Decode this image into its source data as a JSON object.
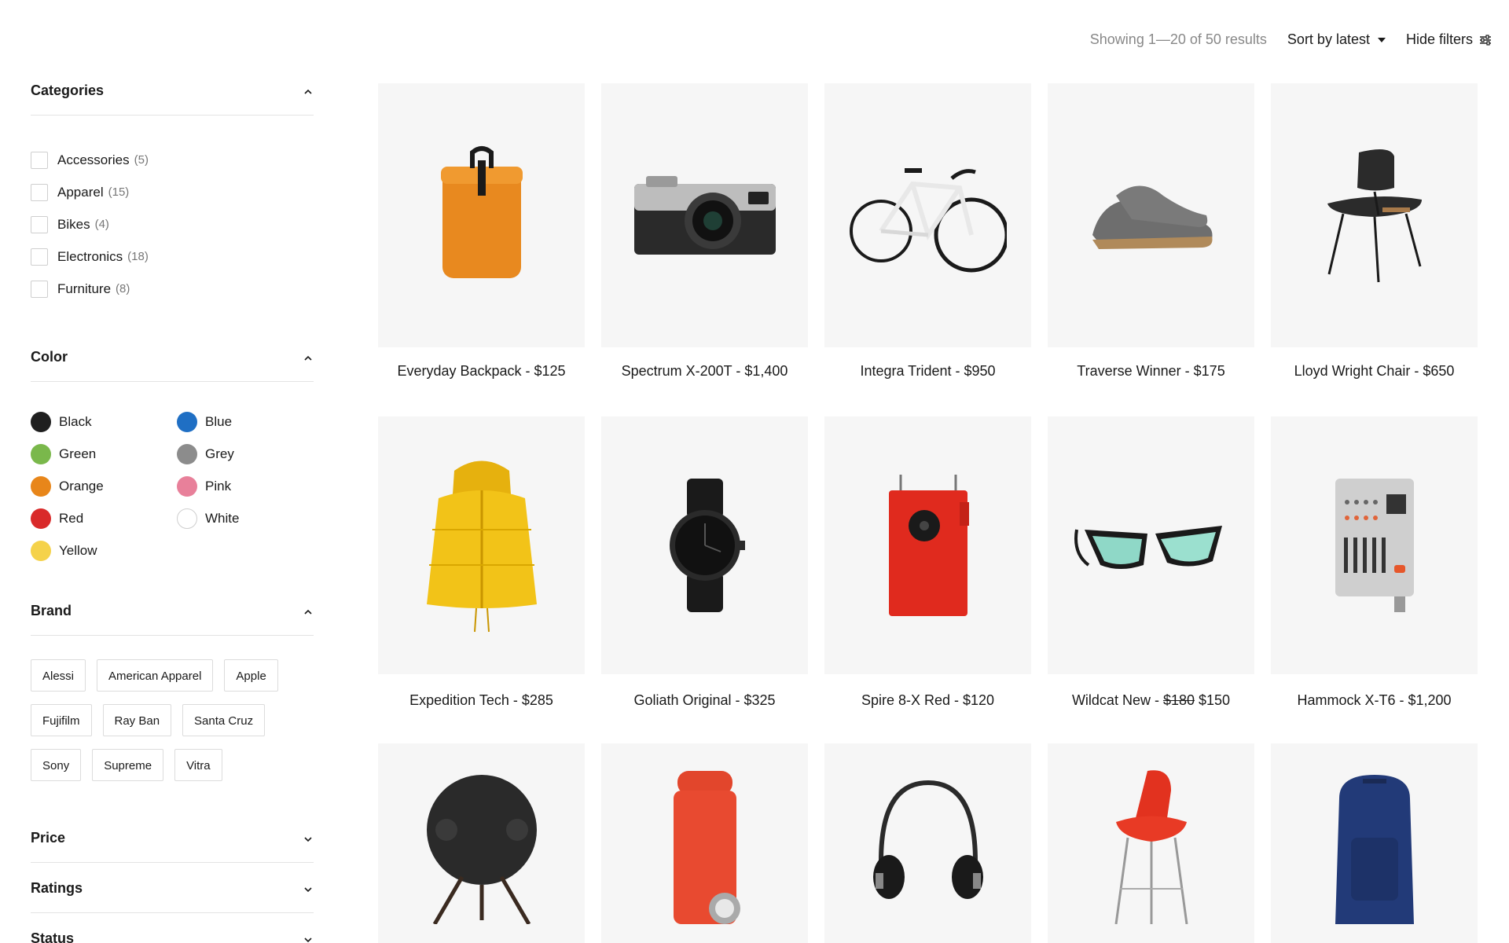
{
  "topbar": {
    "results": "Showing 1—20 of 50 results",
    "sort_label": "Sort by latest",
    "hide_filters": "Hide filters"
  },
  "filters": {
    "categories": {
      "title": "Categories",
      "items": [
        {
          "label": "Accessories",
          "count": "(5)"
        },
        {
          "label": "Apparel",
          "count": "(15)"
        },
        {
          "label": "Bikes",
          "count": "(4)"
        },
        {
          "label": "Electronics",
          "count": "(18)"
        },
        {
          "label": "Furniture",
          "count": "(8)"
        }
      ]
    },
    "color": {
      "title": "Color",
      "items": [
        {
          "label": "Black",
          "hex": "#1f1f1f"
        },
        {
          "label": "Blue",
          "hex": "#1f6fc4"
        },
        {
          "label": "Green",
          "hex": "#7ab84b"
        },
        {
          "label": "Grey",
          "hex": "#8c8c8c"
        },
        {
          "label": "Orange",
          "hex": "#e8861a"
        },
        {
          "label": "Pink",
          "hex": "#e8809a"
        },
        {
          "label": "Red",
          "hex": "#d92a2a"
        },
        {
          "label": "White",
          "hex": "#ffffff"
        },
        {
          "label": "Yellow",
          "hex": "#f5d24a"
        }
      ]
    },
    "brand": {
      "title": "Brand",
      "items": [
        "Alessi",
        "American Apparel",
        "Apple",
        "Fujifilm",
        "Ray Ban",
        "Santa Cruz",
        "Sony",
        "Supreme",
        "Vitra"
      ]
    },
    "price": {
      "title": "Price"
    },
    "ratings": {
      "title": "Ratings"
    },
    "status": {
      "title": "Status"
    }
  },
  "products": [
    {
      "name": "Everyday Backpack - $125",
      "icon": "backpack-icon"
    },
    {
      "name": "Spectrum X-200T - $1,400",
      "icon": "camera-icon"
    },
    {
      "name": "Integra Trident - $950",
      "icon": "bike-icon"
    },
    {
      "name": "Traverse Winner - $175",
      "icon": "sneaker-icon"
    },
    {
      "name": "Lloyd Wright Chair - $650",
      "icon": "chair-icon"
    },
    {
      "name": "Expedition Tech - $285",
      "icon": "jacket-icon"
    },
    {
      "name": "Goliath Original - $325",
      "icon": "watch-icon"
    },
    {
      "name": "Spire 8-X Red - $120",
      "icon": "device-icon"
    },
    {
      "name_prefix": "Wildcat New - ",
      "old_price": "$180",
      "new_price": "$150",
      "icon": "sunglasses-icon"
    },
    {
      "name": "Hammock X-T6 - $1,200",
      "icon": "synth-icon"
    },
    {
      "name": "",
      "icon": "speaker-icon"
    },
    {
      "name": "",
      "icon": "bottle-icon"
    },
    {
      "name": "",
      "icon": "headphones-icon"
    },
    {
      "name": "",
      "icon": "stool-icon"
    },
    {
      "name": "",
      "icon": "blue-backpack-icon"
    }
  ]
}
